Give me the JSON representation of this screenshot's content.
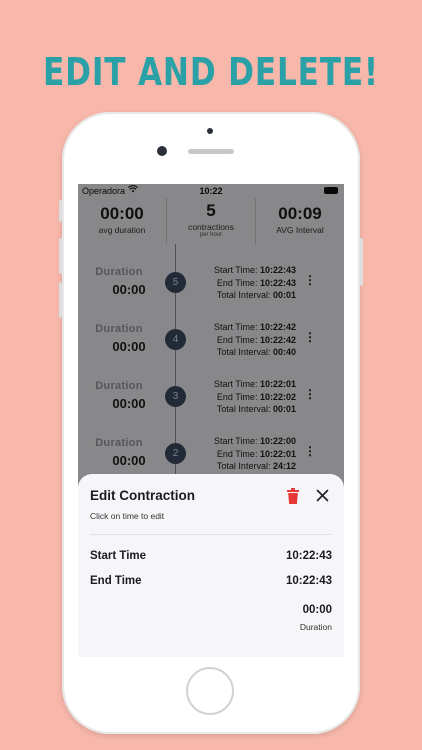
{
  "headline": "EDIT AND DELETE!",
  "status_bar": {
    "carrier": "Operadora",
    "time": "10:22"
  },
  "stats": [
    {
      "value": "00:00",
      "label": "avg duration",
      "sub": ""
    },
    {
      "value": "5",
      "label": "contractions",
      "sub": "per hour"
    },
    {
      "value": "00:09",
      "label": "AVG Interval",
      "sub": ""
    }
  ],
  "contractions": [
    {
      "number": "5",
      "duration_label": "Duration",
      "duration": "00:00",
      "start_label": "Start Time:",
      "start": "10:22:43",
      "end_label": "End Time:",
      "end": "10:22:43",
      "interval_label": "Total Interval:",
      "interval": "00:01"
    },
    {
      "number": "4",
      "duration_label": "Duration",
      "duration": "00:00",
      "start_label": "Start Time:",
      "start": "10:22:42",
      "end_label": "End Time:",
      "end": "10:22:42",
      "interval_label": "Total Interval:",
      "interval": "00:40"
    },
    {
      "number": "3",
      "duration_label": "Duration",
      "duration": "00:00",
      "start_label": "Start Time:",
      "start": "10:22:01",
      "end_label": "End Time:",
      "end": "10:22:02",
      "interval_label": "Total Interval:",
      "interval": "00:01"
    },
    {
      "number": "2",
      "duration_label": "Duration",
      "duration": "00:00",
      "start_label": "Start Time:",
      "start": "10:22:00",
      "end_label": "End Time:",
      "end": "10:22:01",
      "interval_label": "Total Interval:",
      "interval": "24:12"
    }
  ],
  "sheet": {
    "title": "Edit Contraction",
    "hint": "Click on time to edit",
    "start_label": "Start Time",
    "start_value": "10:22:43",
    "end_label": "End Time",
    "end_value": "10:22:43",
    "duration_value": "00:00",
    "duration_caption": "Duration",
    "delete_icon": "trash-icon",
    "close_icon": "close-icon"
  },
  "colors": {
    "background": "#f7b7aa",
    "headline": "#2aa1a6",
    "badge": "#3e4b63",
    "delete": "#e53935"
  }
}
